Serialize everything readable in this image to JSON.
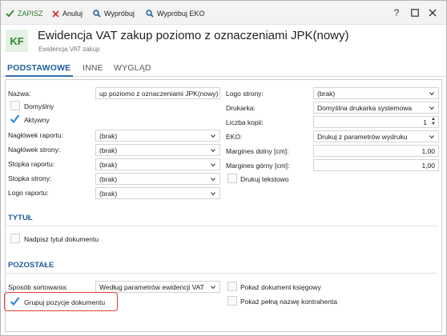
{
  "toolbar": {
    "save_label": "ZAPISZ",
    "cancel_label": "Anuluj",
    "test_label": "Wypróbuj",
    "test_eko_label": "Wypróbuj EKO",
    "help_label": "?"
  },
  "header": {
    "logo_text": "KF",
    "title": "Ewidencja VAT zakup poziomo z oznaczeniami JPK(nowy)",
    "subtitle": "Ewidencja VAT zakup"
  },
  "tabs": [
    {
      "label": "PODSTAWOWE"
    },
    {
      "label": "INNE"
    },
    {
      "label": "WYGLĄD"
    }
  ],
  "left": {
    "name_label": "Nazwa:",
    "name_value": "up poziomo z oznaczeniami JPK(nowy)",
    "default_label": "Domyślny",
    "active_label": "Aktywny",
    "report_header_label": "Nagłówek raportu:",
    "report_header_value": "(brak)",
    "page_header_label": "Nagłówek strony:",
    "page_header_value": "(brak)",
    "report_footer_label": "Stopka raportu:",
    "report_footer_value": "(brak)",
    "page_footer_label": "Stopka strony:",
    "page_footer_value": "(brak)",
    "report_logo_label": "Logo raportu:",
    "report_logo_value": "(brak)"
  },
  "right": {
    "page_logo_label": "Logo strony:",
    "page_logo_value": "(brak)",
    "printer_label": "Drukarka:",
    "printer_value": "Domyślna drukarka systemowa",
    "copies_label": "Liczba kopii:",
    "copies_value": "1",
    "eko_label": "EKO:",
    "eko_value": "Drukuj z parametrów wydruku",
    "margin_bottom_label": "Margines dolny [cm]:",
    "margin_bottom_value": "1,00",
    "margin_top_label": "Margines górny [cm]:",
    "margin_top_value": "1,00",
    "text_print_label": "Drukuj tekstowo"
  },
  "title_section": {
    "heading": "TYTUŁ",
    "print_title_label": "Nadpisz tytuł dokumentu"
  },
  "other_section": {
    "heading": "POZOSTAŁE",
    "sort_label": "Sposób sortowania:",
    "sort_value": "Według parametrów ewidencji VAT",
    "group_label": "Grupuj pozycje dokumentu",
    "show_ledger_label": "Pokaż dokument księgowy",
    "show_contractor_label": "Pokaż pełną nazwę kontrahenta"
  },
  "colors": {
    "accent": "#1e5d9c",
    "save_green": "#2b7d2b",
    "check_blue": "#2f7fd0",
    "highlight_red": "#e53935"
  }
}
